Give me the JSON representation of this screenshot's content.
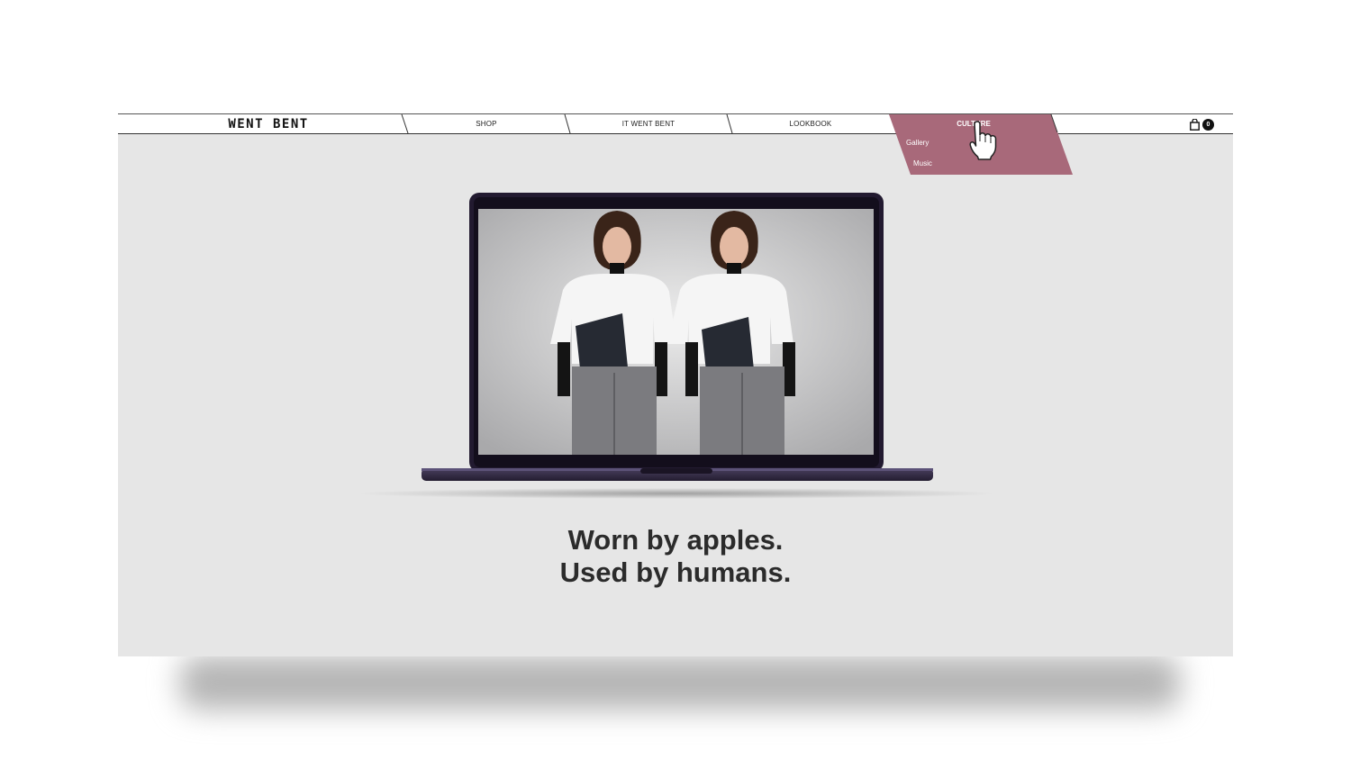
{
  "brand": {
    "logo_text": "WENT BENT"
  },
  "nav": {
    "items": [
      {
        "label": "SHOP"
      },
      {
        "label": "IT WENT BENT"
      },
      {
        "label": "LOOKBOOK"
      },
      {
        "label": "CULTURE"
      }
    ],
    "dropdown": [
      {
        "label": "Gallery"
      },
      {
        "label": "Music"
      }
    ],
    "cart_count": "0"
  },
  "hero": {
    "headline_line1": "Worn by apples.",
    "headline_line2": "Used by humans."
  },
  "colors": {
    "accent": "#a8697a",
    "page_bg": "#e6e6e6",
    "laptop": "#2a2238",
    "text": "#2b2b2b"
  },
  "icons": {
    "cart": "shopping-bag-icon",
    "cursor": "hand-pointer-icon"
  }
}
